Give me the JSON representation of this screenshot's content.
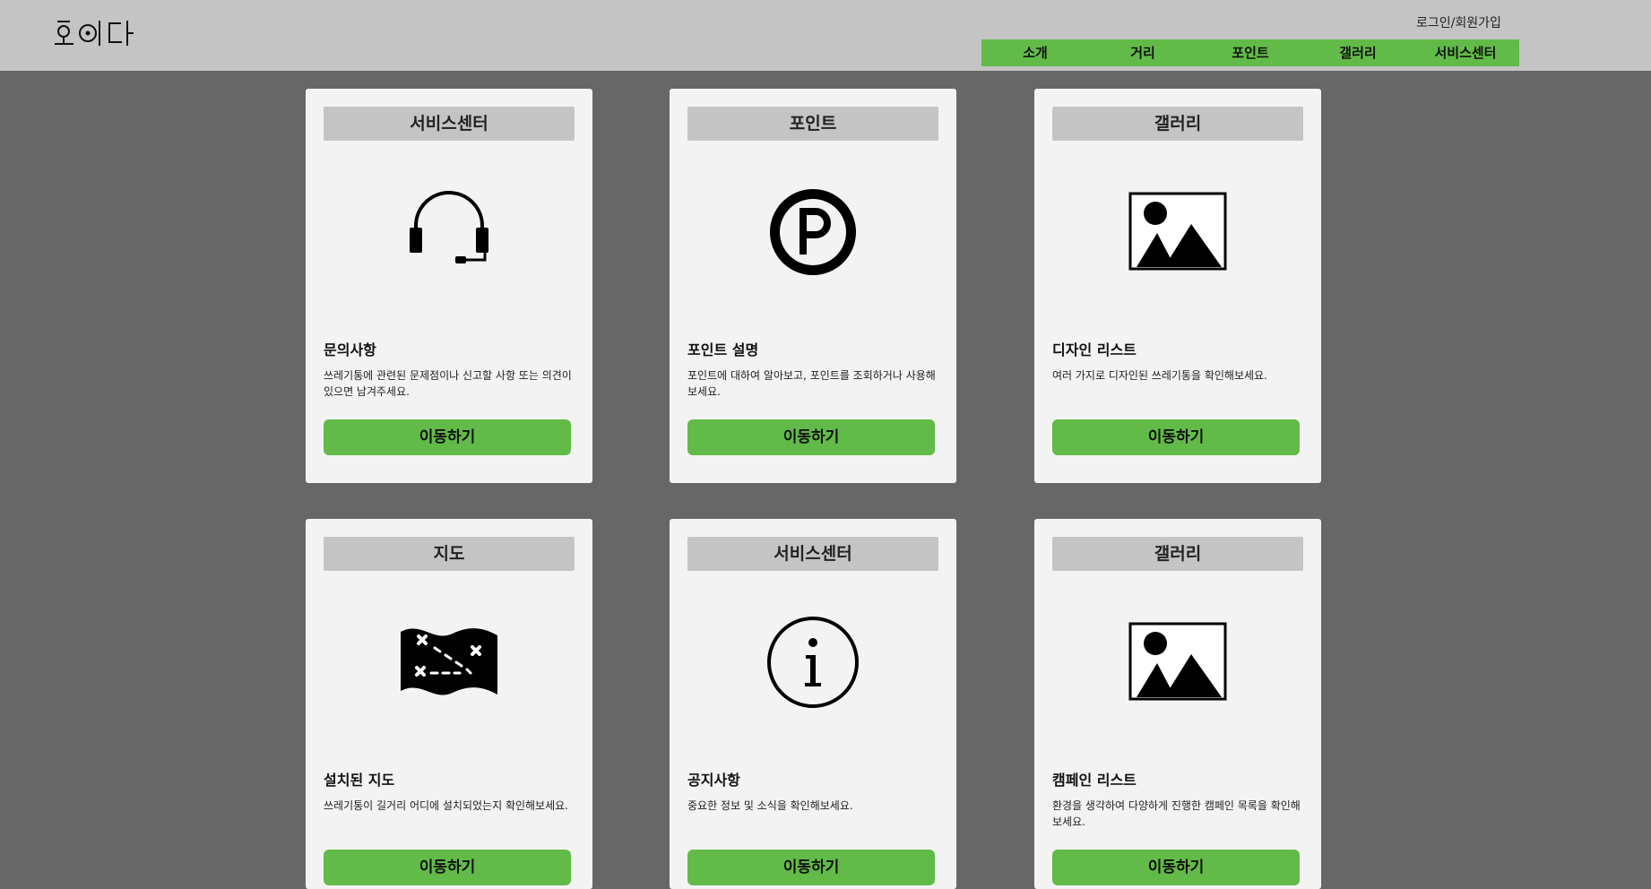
{
  "header": {
    "logo_text": "호이다",
    "login_link": "로그인/회원가입",
    "nav": [
      {
        "label": "소개"
      },
      {
        "label": "거리"
      },
      {
        "label": "포인트"
      },
      {
        "label": "갤러리"
      },
      {
        "label": "서비스센터"
      }
    ]
  },
  "colors": {
    "header_bg": "#c4c4c4",
    "page_bg": "#676767",
    "accent_green": "#62bb48",
    "card_bg": "#f3f3f3"
  },
  "cards": [
    {
      "header": "서비스센터",
      "icon": "headset-icon",
      "title": "문의사항",
      "desc": "쓰레기통에 관련된 문제점이나 신고할 사항 또는 의견이 있으면 남겨주세요.",
      "button": "이동하기"
    },
    {
      "header": "포인트",
      "icon": "point-icon",
      "title": "포인트 설명",
      "desc": "포인트에 대하여 알아보고, 포인트를 조회하거나 사용해 보세요.",
      "button": "이동하기"
    },
    {
      "header": "갤러리",
      "icon": "image-icon",
      "title": "디자인 리스트",
      "desc": "여러 가지로 디자인된 쓰레기통을 확인해보세요.",
      "button": "이동하기"
    },
    {
      "header": "지도",
      "icon": "treasure-map-icon",
      "title": "설치된 지도",
      "desc": "쓰레기통이 길거리 어디에 설치되었는지 확인해보세요.",
      "button": "이동하기"
    },
    {
      "header": "서비스센터",
      "icon": "info-icon",
      "title": "공지사항",
      "desc": "중요한 정보 및 소식을 확인해보세요.",
      "button": "이동하기"
    },
    {
      "header": "갤러리",
      "icon": "image-icon",
      "title": "캠페인 리스트",
      "desc": "환경을 생각하여 다양하게 진행한 캠페인 목록을 확인해 보세요.",
      "button": "이동하기"
    }
  ]
}
